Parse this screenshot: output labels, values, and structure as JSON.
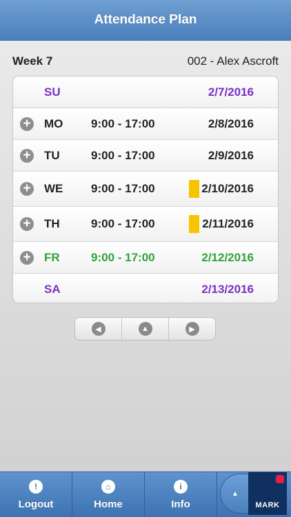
{
  "header": {
    "title": "Attendance Plan"
  },
  "subheader": {
    "week": "Week 7",
    "employee": "002 - Alex Ascroft"
  },
  "colors": {
    "accent": "#4a7fbb",
    "weekend": "#7b2fc4",
    "today": "#2fa23a",
    "marker": "#f8c400"
  },
  "days": [
    {
      "day": "SU",
      "time": "",
      "date": "2/7/2016"
    },
    {
      "day": "MO",
      "time": "9:00 - 17:00",
      "date": "2/8/2016"
    },
    {
      "day": "TU",
      "time": "9:00 - 17:00",
      "date": "2/9/2016"
    },
    {
      "day": "WE",
      "time": "9:00 - 17:00",
      "date": "2/10/2016"
    },
    {
      "day": "TH",
      "time": "9:00 - 17:00",
      "date": "2/11/2016"
    },
    {
      "day": "FR",
      "time": "9:00 - 17:00",
      "date": "2/12/2016"
    },
    {
      "day": "SA",
      "time": "",
      "date": "2/13/2016"
    }
  ],
  "pager": {
    "prev_icon": "chevron-left-icon",
    "up_icon": "chevron-up-icon",
    "next_icon": "chevron-right-icon"
  },
  "tabbar": {
    "items": [
      {
        "label": "Logout",
        "icon": "warning-icon"
      },
      {
        "label": "Home",
        "icon": "home-icon"
      },
      {
        "label": "Info",
        "icon": "info-icon"
      }
    ],
    "brand": "MARK"
  }
}
